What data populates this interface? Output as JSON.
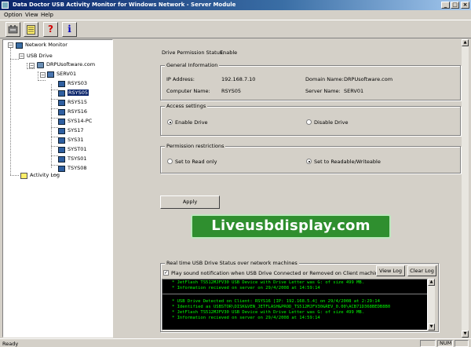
{
  "window": {
    "title": "Data Doctor USB Activity Monitor for Windows Network - Server Module",
    "controls": [
      "_",
      "□",
      "×"
    ]
  },
  "menu": [
    "Option",
    "View",
    "Help"
  ],
  "toolbar": [
    {
      "icon": "usb-device-icon"
    },
    {
      "icon": "notepad-icon"
    },
    {
      "icon": "help-icon",
      "glyph": "?"
    },
    {
      "icon": "info-icon",
      "glyph": "i"
    }
  ],
  "tree": {
    "root": "Network Monitor",
    "usb_drive": "USB Drive",
    "domain": "DRPUsoftware.com",
    "server": "SERV01",
    "clients": [
      "RSYS03",
      "RSYS05",
      "RSYS15",
      "RSYS16",
      "SYS14-PC",
      "SYS17",
      "SYS31",
      "SYST01",
      "TSYS01",
      "TSYS08"
    ],
    "selected": "RSYS05",
    "activity_log": "Activity Log"
  },
  "main": {
    "permission_status_label": "Drive Permission Status:",
    "permission_status_value": "Enable",
    "general_info": {
      "title": "General Information",
      "ip_label": "IP Address:",
      "ip_value": "192.168.7.10",
      "domain_label": "Domain Name:",
      "domain_value": "DRPUsoftware.com",
      "computer_label": "Computer Name:",
      "computer_value": "RSYS05",
      "server_label": "Server Name:",
      "server_value": "SERV01"
    },
    "access": {
      "title": "Access settings",
      "enable": "Enable Drive",
      "disable": "Disable Drive",
      "selected": "enable"
    },
    "permission": {
      "title": "Permission restrictions",
      "read_only": "Set to Read only",
      "read_write": "Set to Readable/Writeable",
      "selected": "read_write"
    },
    "apply": "Apply",
    "banner": "Liveusbdisplay.com",
    "realtime": {
      "title": "Real time USB Drive Status over network machines",
      "sound_label": "Play sound notification when USB Drive Connected or Removed on Client machines",
      "sound_checked": true,
      "view_log": "View Log",
      "clear_log": "Clear Log",
      "log_top": [
        "* JetFlash TS512MJFV30 USB Device  with Drive Letter was G: of size 499 MB.",
        "* Information recieved on server on 29/4/2008 at 14:59:14"
      ],
      "log_bottom": [
        "* USB Drive Detected on Client: RSYS16 [IP: 192.168.5.4] on 29/4/2008 at 2:29:14",
        "* Identified as USBSTOR\\DISK&VEN_JETFLASH&PROD_TS512MJFV30&REV_0.00\\ACB71D368BEDB8B0",
        "* JetFlash TS512MJFV30 USB Device  with Drive Letter was G: of size 499 MB.",
        "* Information recieved on server on 29/4/2008 at 14:59:14"
      ]
    }
  },
  "status": {
    "text": "Ready",
    "num": "NUM"
  }
}
